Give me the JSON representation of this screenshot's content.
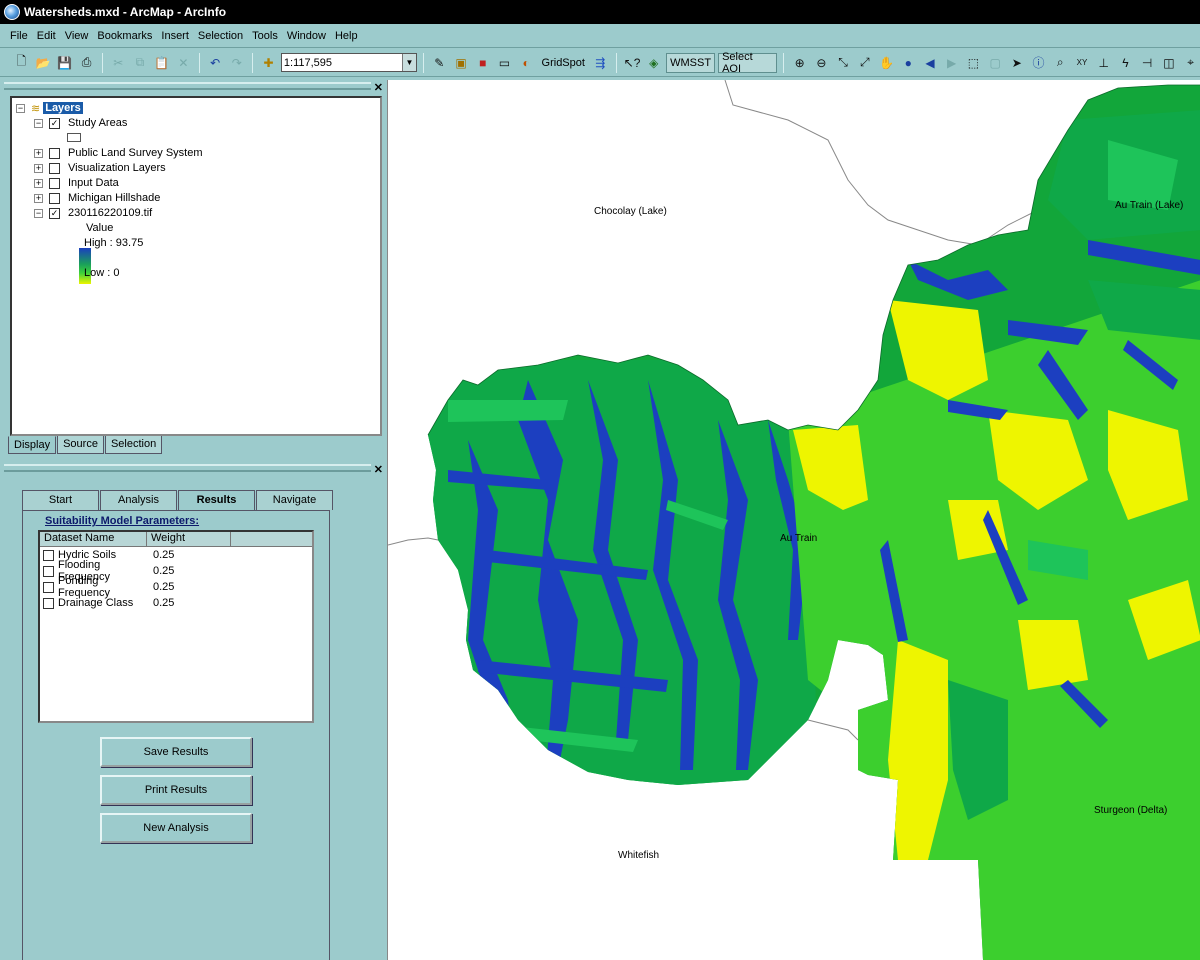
{
  "window": {
    "title": "Watersheds.mxd - ArcMap - ArcInfo"
  },
  "menu": [
    "File",
    "Edit",
    "View",
    "Bookmarks",
    "Insert",
    "Selection",
    "Tools",
    "Window",
    "Help"
  ],
  "toolbar": {
    "scale": "1:117,595",
    "gridspot_label": "GridSpot",
    "wmsst_label": "WMSST",
    "select_aoi_label": "Select AOI"
  },
  "toc": {
    "root_label": "Layers",
    "layers": [
      {
        "label": "Study Areas",
        "checked": true,
        "expanded": true
      },
      {
        "label": "Public Land Survey System",
        "checked": false,
        "expanded": false
      },
      {
        "label": "Visualization Layers",
        "checked": false,
        "expanded": false
      },
      {
        "label": "Input Data",
        "checked": false,
        "expanded": false
      },
      {
        "label": "Michigan Hillshade",
        "checked": false,
        "expanded": false
      },
      {
        "label": "230116220109.tif",
        "checked": true,
        "expanded": true
      }
    ],
    "legend": {
      "title": "Value",
      "high": "High : 93.75",
      "low": "Low : 0"
    },
    "tabs": [
      "Display",
      "Source",
      "Selection"
    ],
    "active_tab": "Display"
  },
  "wizard": {
    "tabs": [
      "Start",
      "Analysis",
      "Results",
      "Navigate"
    ],
    "active_tab": "Results",
    "params_title": "Suitability Model Parameters:",
    "columns": [
      "Dataset Name",
      "Weight"
    ],
    "rows": [
      {
        "name": "Hydric Soils",
        "weight": "0.25"
      },
      {
        "name": "Flooding Frequency",
        "weight": "0.25"
      },
      {
        "name": "Ponding Frequency",
        "weight": "0.25"
      },
      {
        "name": "Drainage Class",
        "weight": "0.25"
      }
    ],
    "buttons": {
      "save": "Save Results",
      "print": "Print Results",
      "new": "New Analysis"
    }
  },
  "map": {
    "labels": {
      "chocolay": "Chocolay (Lake)",
      "autrain_lake": "Au Train (Lake)",
      "autrain": "Au Train",
      "sturgeon": "Sturgeon (Delta)",
      "whitefish": "Whitefish"
    },
    "colors": {
      "high": "#1a3fbf",
      "mid": "#12a63a",
      "low": "#eef500",
      "green": "#3ccf2e"
    }
  }
}
